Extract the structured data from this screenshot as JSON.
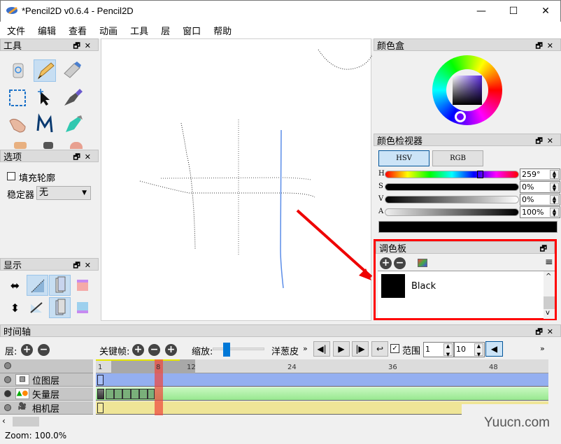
{
  "window": {
    "title": "*Pencil2D v0.6.4 - Pencil2D",
    "minimize_icon": "—",
    "maximize_icon": "☐",
    "close_icon": "✕"
  },
  "menu": [
    "文件",
    "编辑",
    "查看",
    "动画",
    "工具",
    "层",
    "窗口",
    "帮助"
  ],
  "panels": {
    "tools": {
      "title": "工具",
      "float_icon": "🗗",
      "close_icon": "✕",
      "items": [
        "clear",
        "pencil",
        "eraser",
        "select",
        "move",
        "pen",
        "hand",
        "polyline",
        "bucket"
      ]
    },
    "options": {
      "title": "选项",
      "fill_contour_label": "填充轮廓",
      "fill_contour_checked": false,
      "stabilizer_label": "稳定器",
      "stabilizer_value": "无"
    },
    "display": {
      "title": "显示"
    },
    "color_box": {
      "title": "颜色盒"
    },
    "color_inspector": {
      "title": "颜色检视器",
      "tab_hsv": "HSV",
      "tab_rgb": "RGB",
      "active_tab": "HSV",
      "h_label": "H",
      "s_label": "S",
      "v_label": "V",
      "a_label": "A",
      "h_value": "259°",
      "s_value": "0%",
      "v_value": "0%",
      "a_value": "100%",
      "hue_fraction": 0.72,
      "current_color": "#000000"
    },
    "palette": {
      "title": "调色板",
      "colors": [
        {
          "name": "Black",
          "hex": "#000000"
        }
      ],
      "highlight_color": "#ff0000"
    }
  },
  "timeline": {
    "title": "时间轴",
    "layer_label": "层:",
    "keyframe_label": "关键帧:",
    "zoom_label": "缩放:",
    "onion_label": "洋葱皮",
    "more": "»",
    "range_label": "范围",
    "range_checked": true,
    "range_start": "1",
    "range_end": "10",
    "current_frame": "8",
    "ruler_labels": [
      "1",
      "8",
      "12",
      "24",
      "36",
      "48"
    ],
    "layers": [
      {
        "name": "位图层",
        "type": "bitmap",
        "color": "#94aff0"
      },
      {
        "name": "矢量层",
        "type": "vector",
        "color": "#a8f0a0"
      },
      {
        "name": "相机层",
        "type": "camera",
        "color": "#efe597"
      }
    ]
  },
  "status": {
    "zoom": "Zoom: 100.0%"
  },
  "watermark": "Yuucn.com"
}
